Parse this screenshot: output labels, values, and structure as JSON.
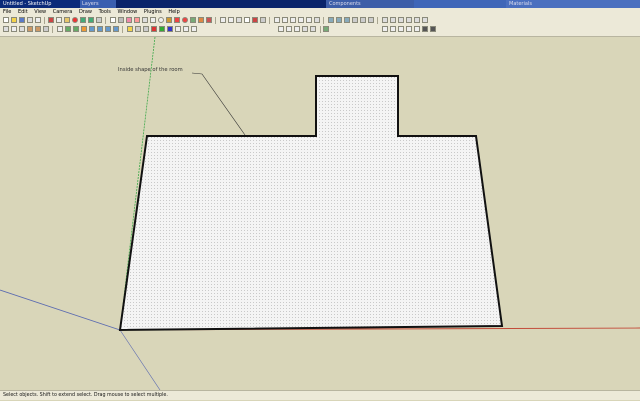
{
  "window": {
    "title": "Untitled - SketchUp",
    "panel_titles": [
      "Layers",
      "Components",
      "Materials"
    ]
  },
  "menu": [
    "File",
    "Edit",
    "View",
    "Camera",
    "Draw",
    "Tools",
    "Window",
    "Plugins",
    "Help"
  ],
  "toolbar": {
    "time_left": "05:42 AM",
    "noon_label": "Noon",
    "time_right": "04:46 PM",
    "layer_value": "Layer0"
  },
  "canvas": {
    "annotation": "Inside shape of the room"
  },
  "status": {
    "text": "Select objects. Shift to extend select. Drag mouse to select multiple."
  }
}
